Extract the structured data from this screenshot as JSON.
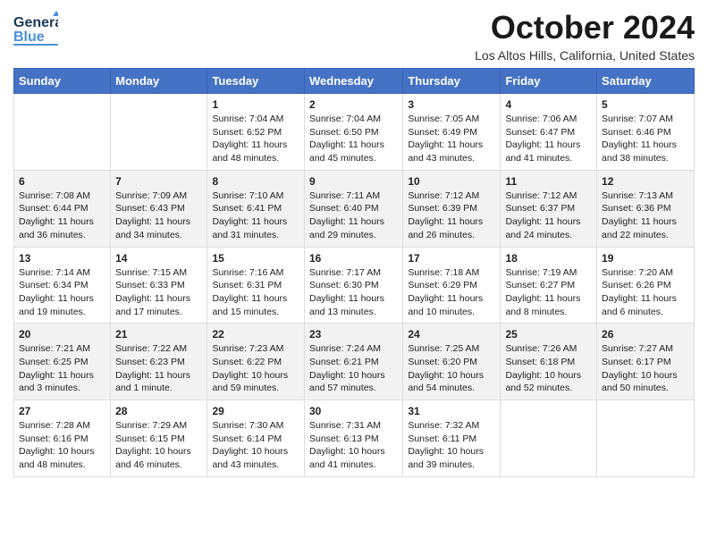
{
  "header": {
    "logo_general": "General",
    "logo_blue": "Blue",
    "month": "October 2024",
    "location": "Los Altos Hills, California, United States"
  },
  "days_of_week": [
    "Sunday",
    "Monday",
    "Tuesday",
    "Wednesday",
    "Thursday",
    "Friday",
    "Saturday"
  ],
  "weeks": [
    [
      {
        "day": "",
        "sunrise": "",
        "sunset": "",
        "daylight": ""
      },
      {
        "day": "",
        "sunrise": "",
        "sunset": "",
        "daylight": ""
      },
      {
        "day": "1",
        "sunrise": "Sunrise: 7:04 AM",
        "sunset": "Sunset: 6:52 PM",
        "daylight": "Daylight: 11 hours and 48 minutes."
      },
      {
        "day": "2",
        "sunrise": "Sunrise: 7:04 AM",
        "sunset": "Sunset: 6:50 PM",
        "daylight": "Daylight: 11 hours and 45 minutes."
      },
      {
        "day": "3",
        "sunrise": "Sunrise: 7:05 AM",
        "sunset": "Sunset: 6:49 PM",
        "daylight": "Daylight: 11 hours and 43 minutes."
      },
      {
        "day": "4",
        "sunrise": "Sunrise: 7:06 AM",
        "sunset": "Sunset: 6:47 PM",
        "daylight": "Daylight: 11 hours and 41 minutes."
      },
      {
        "day": "5",
        "sunrise": "Sunrise: 7:07 AM",
        "sunset": "Sunset: 6:46 PM",
        "daylight": "Daylight: 11 hours and 38 minutes."
      }
    ],
    [
      {
        "day": "6",
        "sunrise": "Sunrise: 7:08 AM",
        "sunset": "Sunset: 6:44 PM",
        "daylight": "Daylight: 11 hours and 36 minutes."
      },
      {
        "day": "7",
        "sunrise": "Sunrise: 7:09 AM",
        "sunset": "Sunset: 6:43 PM",
        "daylight": "Daylight: 11 hours and 34 minutes."
      },
      {
        "day": "8",
        "sunrise": "Sunrise: 7:10 AM",
        "sunset": "Sunset: 6:41 PM",
        "daylight": "Daylight: 11 hours and 31 minutes."
      },
      {
        "day": "9",
        "sunrise": "Sunrise: 7:11 AM",
        "sunset": "Sunset: 6:40 PM",
        "daylight": "Daylight: 11 hours and 29 minutes."
      },
      {
        "day": "10",
        "sunrise": "Sunrise: 7:12 AM",
        "sunset": "Sunset: 6:39 PM",
        "daylight": "Daylight: 11 hours and 26 minutes."
      },
      {
        "day": "11",
        "sunrise": "Sunrise: 7:12 AM",
        "sunset": "Sunset: 6:37 PM",
        "daylight": "Daylight: 11 hours and 24 minutes."
      },
      {
        "day": "12",
        "sunrise": "Sunrise: 7:13 AM",
        "sunset": "Sunset: 6:36 PM",
        "daylight": "Daylight: 11 hours and 22 minutes."
      }
    ],
    [
      {
        "day": "13",
        "sunrise": "Sunrise: 7:14 AM",
        "sunset": "Sunset: 6:34 PM",
        "daylight": "Daylight: 11 hours and 19 minutes."
      },
      {
        "day": "14",
        "sunrise": "Sunrise: 7:15 AM",
        "sunset": "Sunset: 6:33 PM",
        "daylight": "Daylight: 11 hours and 17 minutes."
      },
      {
        "day": "15",
        "sunrise": "Sunrise: 7:16 AM",
        "sunset": "Sunset: 6:31 PM",
        "daylight": "Daylight: 11 hours and 15 minutes."
      },
      {
        "day": "16",
        "sunrise": "Sunrise: 7:17 AM",
        "sunset": "Sunset: 6:30 PM",
        "daylight": "Daylight: 11 hours and 13 minutes."
      },
      {
        "day": "17",
        "sunrise": "Sunrise: 7:18 AM",
        "sunset": "Sunset: 6:29 PM",
        "daylight": "Daylight: 11 hours and 10 minutes."
      },
      {
        "day": "18",
        "sunrise": "Sunrise: 7:19 AM",
        "sunset": "Sunset: 6:27 PM",
        "daylight": "Daylight: 11 hours and 8 minutes."
      },
      {
        "day": "19",
        "sunrise": "Sunrise: 7:20 AM",
        "sunset": "Sunset: 6:26 PM",
        "daylight": "Daylight: 11 hours and 6 minutes."
      }
    ],
    [
      {
        "day": "20",
        "sunrise": "Sunrise: 7:21 AM",
        "sunset": "Sunset: 6:25 PM",
        "daylight": "Daylight: 11 hours and 3 minutes."
      },
      {
        "day": "21",
        "sunrise": "Sunrise: 7:22 AM",
        "sunset": "Sunset: 6:23 PM",
        "daylight": "Daylight: 11 hours and 1 minute."
      },
      {
        "day": "22",
        "sunrise": "Sunrise: 7:23 AM",
        "sunset": "Sunset: 6:22 PM",
        "daylight": "Daylight: 10 hours and 59 minutes."
      },
      {
        "day": "23",
        "sunrise": "Sunrise: 7:24 AM",
        "sunset": "Sunset: 6:21 PM",
        "daylight": "Daylight: 10 hours and 57 minutes."
      },
      {
        "day": "24",
        "sunrise": "Sunrise: 7:25 AM",
        "sunset": "Sunset: 6:20 PM",
        "daylight": "Daylight: 10 hours and 54 minutes."
      },
      {
        "day": "25",
        "sunrise": "Sunrise: 7:26 AM",
        "sunset": "Sunset: 6:18 PM",
        "daylight": "Daylight: 10 hours and 52 minutes."
      },
      {
        "day": "26",
        "sunrise": "Sunrise: 7:27 AM",
        "sunset": "Sunset: 6:17 PM",
        "daylight": "Daylight: 10 hours and 50 minutes."
      }
    ],
    [
      {
        "day": "27",
        "sunrise": "Sunrise: 7:28 AM",
        "sunset": "Sunset: 6:16 PM",
        "daylight": "Daylight: 10 hours and 48 minutes."
      },
      {
        "day": "28",
        "sunrise": "Sunrise: 7:29 AM",
        "sunset": "Sunset: 6:15 PM",
        "daylight": "Daylight: 10 hours and 46 minutes."
      },
      {
        "day": "29",
        "sunrise": "Sunrise: 7:30 AM",
        "sunset": "Sunset: 6:14 PM",
        "daylight": "Daylight: 10 hours and 43 minutes."
      },
      {
        "day": "30",
        "sunrise": "Sunrise: 7:31 AM",
        "sunset": "Sunset: 6:13 PM",
        "daylight": "Daylight: 10 hours and 41 minutes."
      },
      {
        "day": "31",
        "sunrise": "Sunrise: 7:32 AM",
        "sunset": "Sunset: 6:11 PM",
        "daylight": "Daylight: 10 hours and 39 minutes."
      },
      {
        "day": "",
        "sunrise": "",
        "sunset": "",
        "daylight": ""
      },
      {
        "day": "",
        "sunrise": "",
        "sunset": "",
        "daylight": ""
      }
    ]
  ]
}
